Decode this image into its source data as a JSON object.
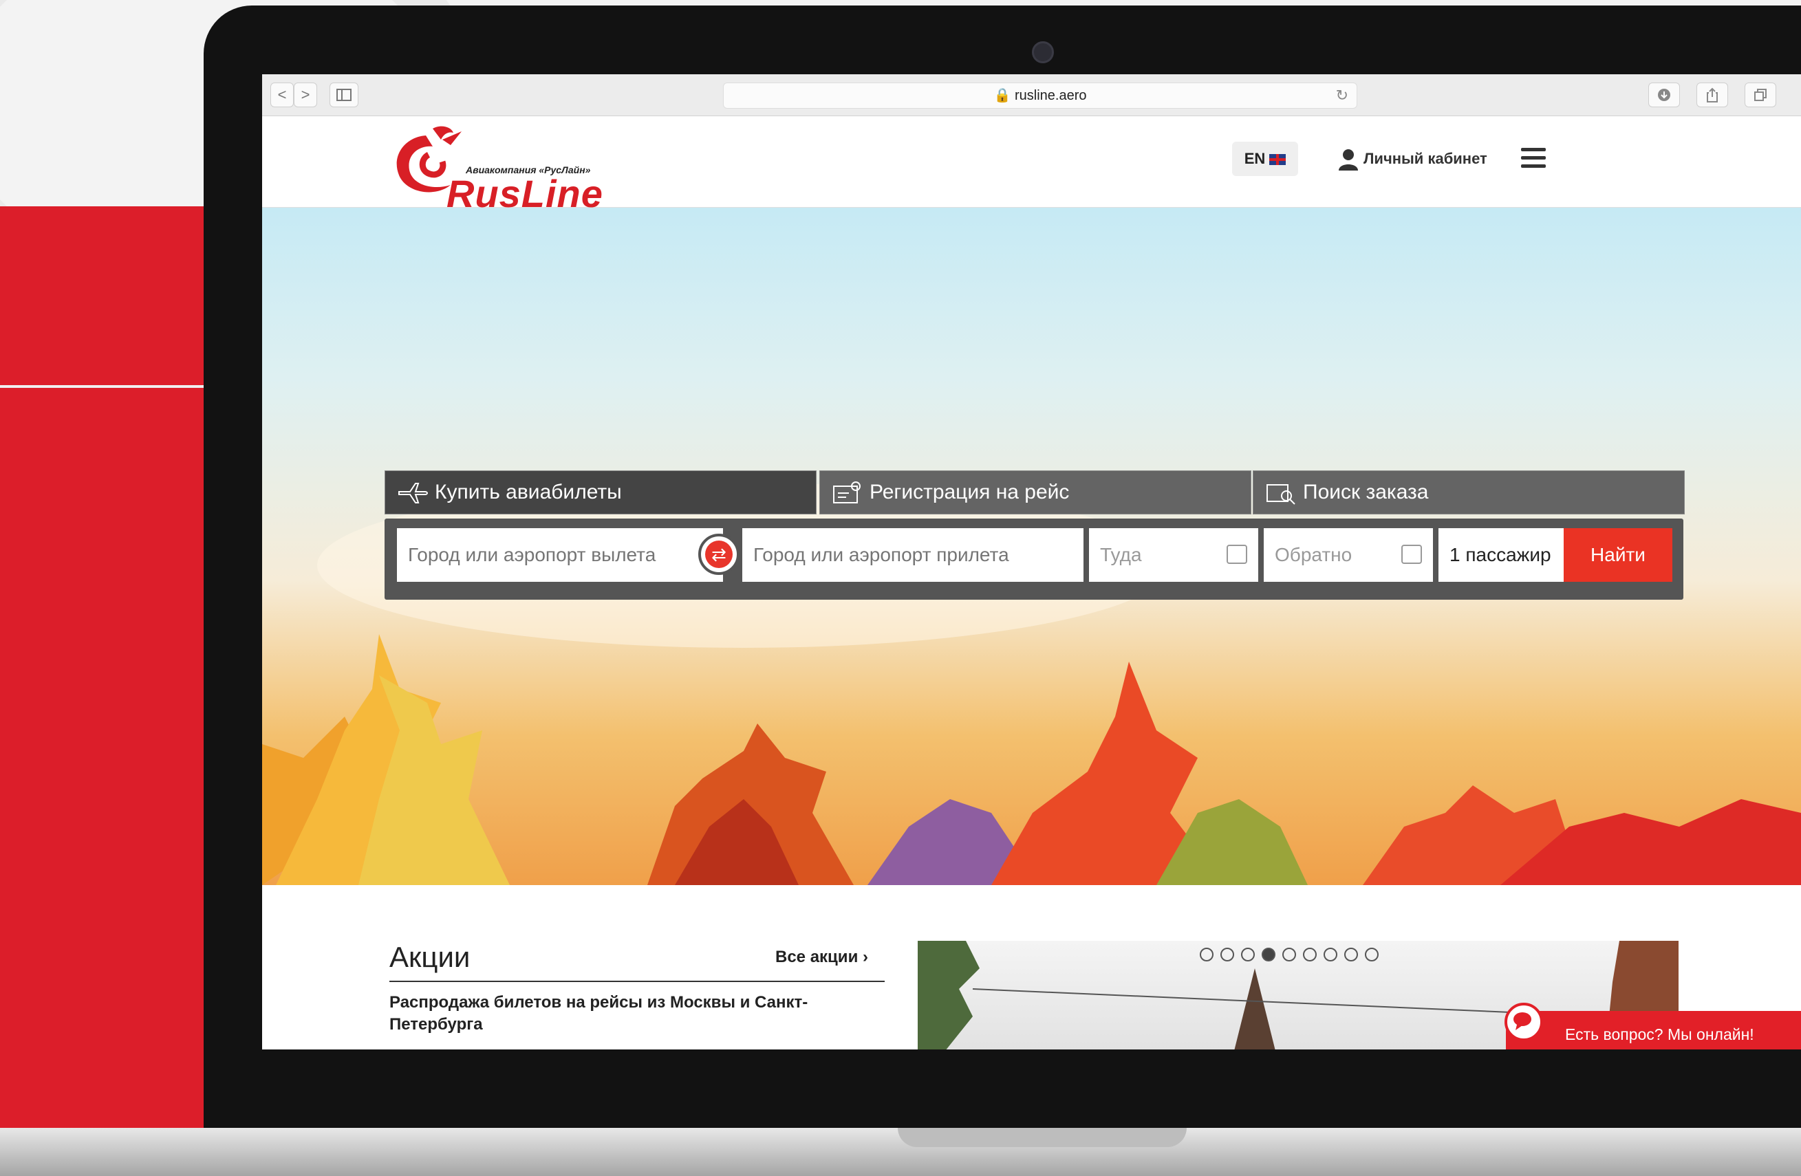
{
  "browser": {
    "url": "rusline.aero",
    "back": "<",
    "forward": ">"
  },
  "header": {
    "logo_subtitle": "Авиакомпания «РусЛайн»",
    "logo_name": "RusLine",
    "lang": "EN",
    "account": "Личный кабинет"
  },
  "booking": {
    "tabs": [
      {
        "label": "Купить авиабилеты"
      },
      {
        "label": "Регистрация на рейс"
      },
      {
        "label": "Поиск заказа"
      }
    ],
    "from_placeholder": "Город или аэропорт вылета",
    "to_placeholder": "Город или аэропорт прилета",
    "depart_placeholder": "Туда",
    "return_placeholder": "Обратно",
    "passengers": "1 пассажир",
    "search_button": "Найти"
  },
  "promos": {
    "title": "Акции",
    "all_link": "Все акции",
    "text": "Распродажа билетов на рейсы из Москвы и Санкт-Петербурга",
    "slides_total": 9,
    "active_slide": 4
  },
  "chat": {
    "label": "Есть вопрос? Мы онлайн!"
  },
  "colors": {
    "brand_red": "#d81f26",
    "search_red": "#ea3324",
    "panel_gray": "#555555"
  }
}
